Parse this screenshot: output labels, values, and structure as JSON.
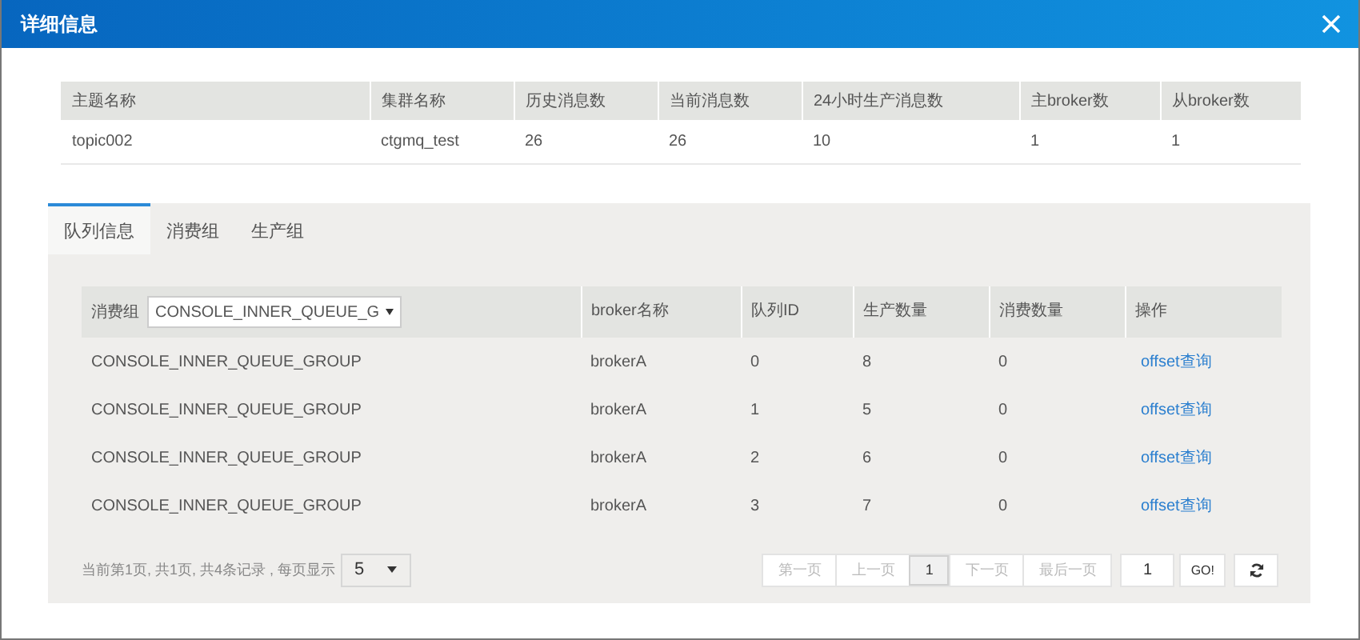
{
  "window": {
    "title": "详细信息"
  },
  "topic_table": {
    "columns": [
      "主题名称",
      "集群名称",
      "历史消息数",
      "当前消息数",
      "24小时生产消息数",
      "主broker数",
      "从broker数"
    ],
    "rows": [
      [
        "topic002",
        "ctgmq_test",
        "26",
        "26",
        "10",
        "1",
        "1"
      ]
    ]
  },
  "tabs": [
    {
      "label": "队列信息",
      "selected": true
    },
    {
      "label": "消费组",
      "selected": false
    },
    {
      "label": "生产组",
      "selected": false
    }
  ],
  "queue_table": {
    "columns": [
      {
        "kind": "filter",
        "label": "消费组",
        "value": "CONSOLE_INNER_QUEUE_G"
      },
      {
        "kind": "text",
        "label": "broker名称"
      },
      {
        "kind": "text",
        "label": "队列ID"
      },
      {
        "kind": "text",
        "label": "生产数量"
      },
      {
        "kind": "text",
        "label": "消费数量"
      },
      {
        "kind": "text",
        "label": "操作"
      }
    ],
    "rows": [
      {
        "cells": [
          "CONSOLE_INNER_QUEUE_GROUP",
          "brokerA",
          "0",
          "8",
          "0"
        ],
        "action": "offset查询"
      },
      {
        "cells": [
          "CONSOLE_INNER_QUEUE_GROUP",
          "brokerA",
          "1",
          "5",
          "0"
        ],
        "action": "offset查询"
      },
      {
        "cells": [
          "CONSOLE_INNER_QUEUE_GROUP",
          "brokerA",
          "2",
          "6",
          "0"
        ],
        "action": "offset查询"
      },
      {
        "cells": [
          "CONSOLE_INNER_QUEUE_GROUP",
          "brokerA",
          "3",
          "7",
          "0"
        ],
        "action": "offset查询"
      }
    ]
  },
  "pagination": {
    "summary": "当前第1页, 共1页, 共4条记录 , 每页显示",
    "page_size": "5",
    "buttons": [
      {
        "label": "第一页",
        "selected": false,
        "disabled": true
      },
      {
        "label": "上一页",
        "selected": false,
        "disabled": true
      },
      {
        "label": "1",
        "selected": true,
        "disabled": false
      },
      {
        "label": "下一页",
        "selected": false,
        "disabled": true
      },
      {
        "label": "最后一页",
        "selected": false,
        "disabled": true
      }
    ],
    "page_input": "1",
    "go": "GO!"
  }
}
